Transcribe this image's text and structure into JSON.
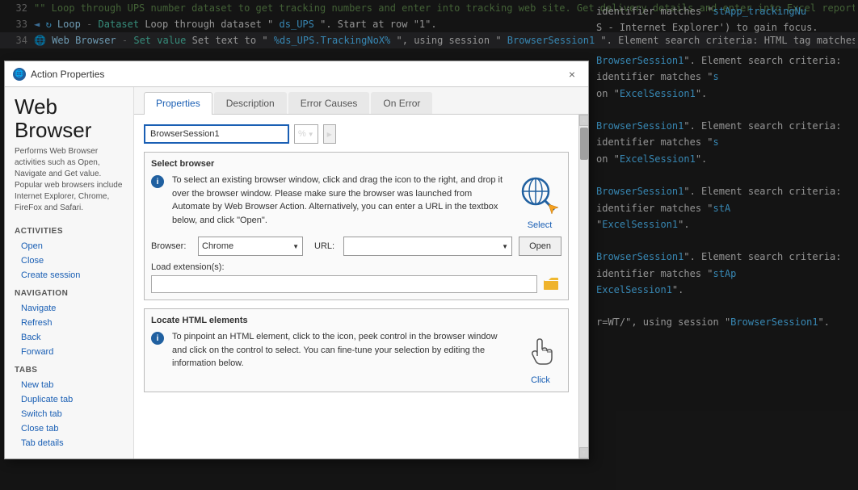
{
  "background": {
    "lines": [
      {
        "num": "32",
        "content": "Loop through UPS number dataset to get tracking numbers and enter into tracking web site. Get delivery details and enter into Excel report.",
        "type": "comment"
      },
      {
        "num": "33",
        "content": "Loop  -  Dataset   Loop through dataset \"ds_UPS\". Start at row \"1\".",
        "type": "code"
      },
      {
        "num": "34",
        "content": "Web Browser  -  Set value   Set text to \"%ds_UPS.TrackingNoX%\", using session \"BrowserSession1\". Element search criteria: HTML tag matches \"stApp_trackingNumber\"",
        "type": "code-active"
      }
    ],
    "right_lines": [
      {
        "text": "identifier matches \"stApp_trackingNu"
      },
      {
        "text": "S - Internet Explorer') to gain focus."
      },
      {
        "text": ""
      },
      {
        "text": "BrowserSession1\". Element search criteria: identifier matches \"s"
      },
      {
        "text": "on \"ExcelSession1\"."
      },
      {
        "text": ""
      },
      {
        "text": "BrowserSession1\". Element search criteria: identifier matches \"s"
      },
      {
        "text": "on \"ExcelSession1\"."
      },
      {
        "text": ""
      },
      {
        "text": "wserSession1\". Element search criteria: identifier matches \"stA"
      },
      {
        "text": "\"ExcelSession1\"."
      },
      {
        "text": ""
      },
      {
        "text": "wserSession1\". Element search criteria: identifier matches \"stAp"
      },
      {
        "text": "ExcelSession1\"."
      },
      {
        "text": ""
      },
      {
        "text": "r=WT/\", using session \"BrowserSession1\"."
      }
    ]
  },
  "dialog": {
    "title": "Action Properties",
    "title_icon": "i",
    "close_label": "×",
    "brand": {
      "title": "Web\nBrowser",
      "description": "Performs Web Browser activities such as Open, Navigate and Get value. Popular web browsers include Internet Explorer, Chrome, FireFox and Safari."
    },
    "tabs": [
      {
        "label": "Properties",
        "active": true
      },
      {
        "label": "Description",
        "active": false
      },
      {
        "label": "Error Causes",
        "active": false
      },
      {
        "label": "On Error",
        "active": false
      }
    ],
    "session": {
      "value": "BrowserSession1",
      "percent": "%",
      "dropdown_arrow": "▼"
    },
    "select_browser": {
      "title": "Select browser",
      "description": "To select an existing browser window, click and drag the icon to the right, and drop it over the browser window. Please make sure the browser was launched from Automate by Web Browser Action. Alternatively, you can enter a URL in the textbox below, and click \"Open\".",
      "select_label": "Select",
      "info_icon": "i"
    },
    "browser_field": {
      "label": "Browser:",
      "value": "Chrome",
      "dropdown_arrow": "▼"
    },
    "url_field": {
      "label": "URL:",
      "value": "",
      "dropdown_arrow": "▼"
    },
    "open_button": "Open",
    "load_extension": {
      "label": "Load extension(s):",
      "value": "",
      "folder_icon": "📁"
    },
    "locate_html": {
      "title": "Locate HTML elements",
      "description": "To pinpoint an HTML element, click to the icon, peek control in the browser window and click on the control to select. You can fine-tune your selection by editing the information below.",
      "click_label": "Click",
      "info_icon": "i"
    }
  },
  "sidebar": {
    "activities_label": "ACTIVITIES",
    "items_activities": [
      {
        "label": "Open"
      },
      {
        "label": "Close"
      },
      {
        "label": "Create session"
      }
    ],
    "navigation_label": "NAVIGATION",
    "items_navigation": [
      {
        "label": "Navigate"
      },
      {
        "label": "Refresh"
      },
      {
        "label": "Back"
      },
      {
        "label": "Forward"
      }
    ],
    "tabs_label": "TABS",
    "items_tabs": [
      {
        "label": "New tab"
      },
      {
        "label": "Duplicate tab"
      },
      {
        "label": "Switch tab"
      },
      {
        "label": "Close tab"
      },
      {
        "label": "Tab details"
      }
    ]
  }
}
